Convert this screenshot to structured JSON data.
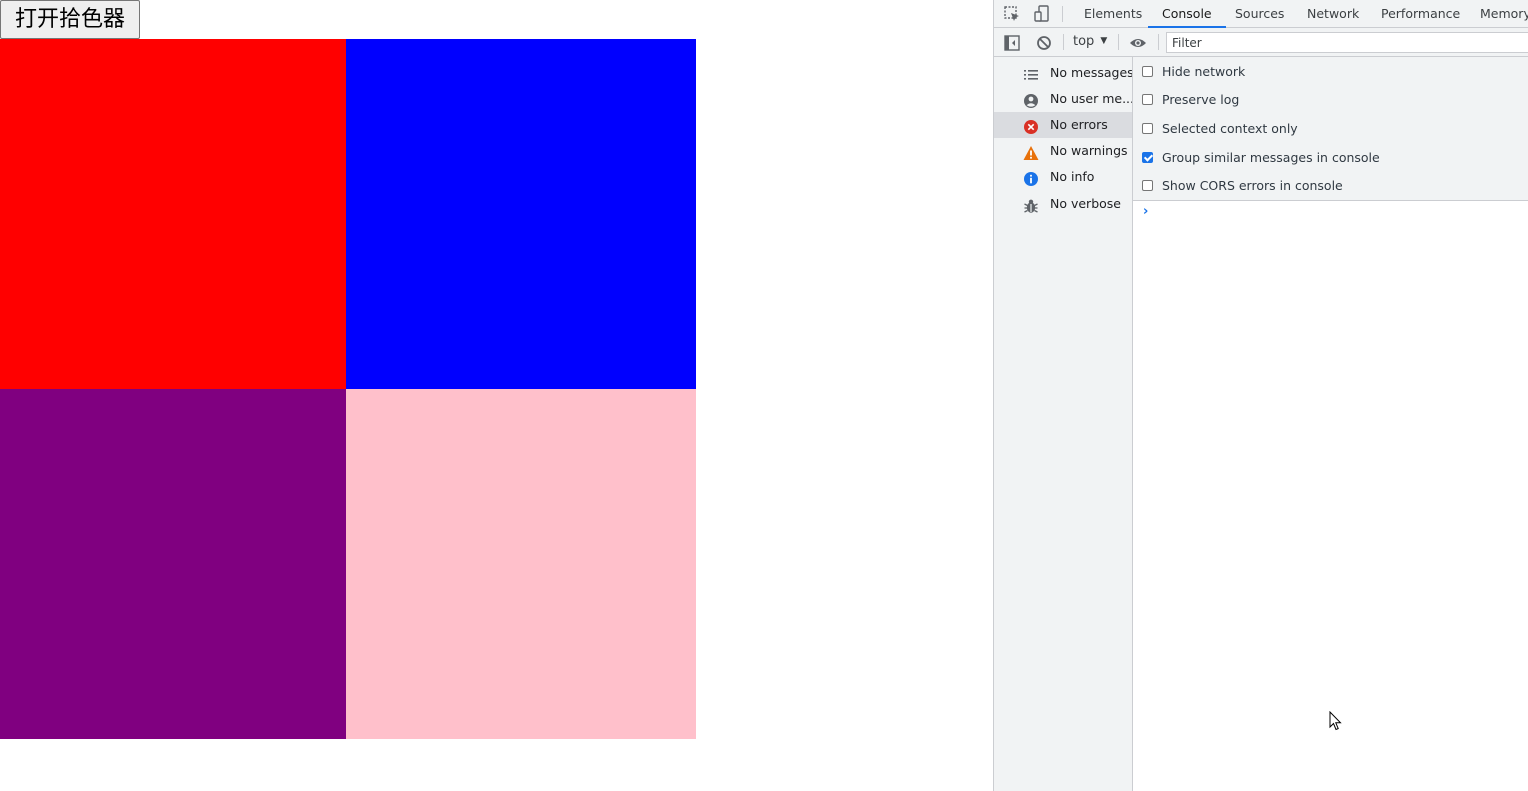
{
  "page": {
    "open_picker_label": "打开拾色器",
    "swatches": [
      {
        "name": "red",
        "color": "#ff0000"
      },
      {
        "name": "blue",
        "color": "#0000ff"
      },
      {
        "name": "purple",
        "color": "#800080"
      },
      {
        "name": "pink",
        "color": "#ffc0cb"
      }
    ]
  },
  "devtools": {
    "tabs": [
      {
        "label": "Elements",
        "active": false
      },
      {
        "label": "Console",
        "active": true
      },
      {
        "label": "Sources",
        "active": false
      },
      {
        "label": "Network",
        "active": false
      },
      {
        "label": "Performance",
        "active": false
      },
      {
        "label": "Memory",
        "active": false
      }
    ],
    "toolbar": {
      "context": "top",
      "filter_placeholder": "Filter",
      "icons": [
        "inspect-element-icon",
        "device-toolbar-icon",
        "sidebar-toggle-icon",
        "clear-console-icon",
        "live-expression-eye-icon"
      ]
    },
    "sidebar": {
      "items": [
        {
          "label": "No messages",
          "icon": "list-icon",
          "selected": false
        },
        {
          "label": "No user me...",
          "icon": "user-icon",
          "selected": false
        },
        {
          "label": "No errors",
          "icon": "error-icon",
          "selected": true
        },
        {
          "label": "No warnings",
          "icon": "warning-icon",
          "selected": false
        },
        {
          "label": "No info",
          "icon": "info-icon",
          "selected": false
        },
        {
          "label": "No verbose",
          "icon": "bug-icon",
          "selected": false
        }
      ]
    },
    "settings": [
      {
        "label": "Hide network",
        "checked": false
      },
      {
        "label": "Preserve log",
        "checked": false
      },
      {
        "label": "Selected context only",
        "checked": false
      },
      {
        "label": "Group similar messages in console",
        "checked": true
      },
      {
        "label": "Show CORS errors in console",
        "checked": false
      }
    ],
    "colors": {
      "accent": "#1a73e8",
      "error": "#d93025",
      "warning": "#e8710a",
      "info": "#1a73e8"
    }
  }
}
